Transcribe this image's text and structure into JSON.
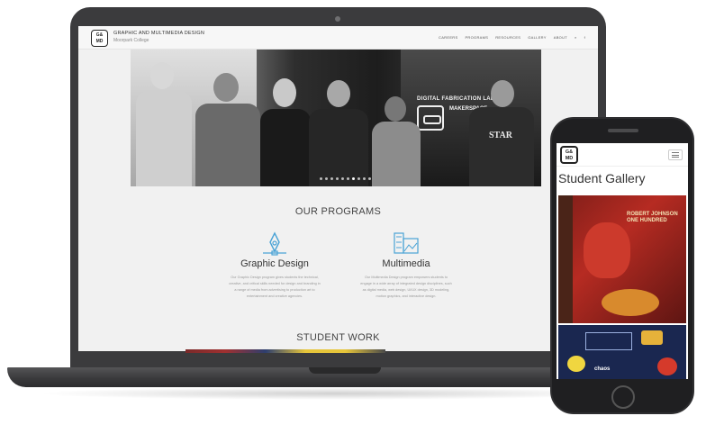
{
  "laptop": {
    "site": {
      "logo_text": "G&\nMD",
      "title": "GRAPHIC AND MULTIMEDIA DESIGN",
      "subtitle": "Moorpark College",
      "nav": [
        "CAREERS",
        "PROGRAMS",
        "RESOURCES",
        "GALLERY",
        "ABOUT",
        "⌕",
        "f"
      ]
    },
    "hero": {
      "sign_line1": "DIGITAL FABRICATION LAB",
      "sign_line2": "MAKERSPACE",
      "shirt_text": "STAR"
    },
    "programs_title": "OUR PROGRAMS",
    "programs": [
      {
        "name": "Graphic Design",
        "icon": "pen-tool-icon",
        "description": "Our Graphic Design program gives students the technical, creative, and critical skills needed for design and branding in a range of media from advertising to production art to entertainment and creative agencies."
      },
      {
        "name": "Multimedia",
        "icon": "film-image-icon",
        "description": "Our Multimedia Design program empowers students to engage in a wide array of integrated design disciplines, such as digital media, web design, UI/UX design, 3D modeling, motion graphics, and interactive design."
      }
    ],
    "work_title": "STUDENT WORK",
    "active_slide": 6,
    "slide_count": 10
  },
  "phone": {
    "logo_text": "G&\nMD",
    "title": "Student Gallery",
    "art1_label": "ROBERT JOHNSON\nONE HUNDRED",
    "art2_text": "chaos"
  },
  "colors": {
    "device": "#3b3b3d",
    "icon_blue": "#4aa3d6",
    "text": "#333333"
  }
}
